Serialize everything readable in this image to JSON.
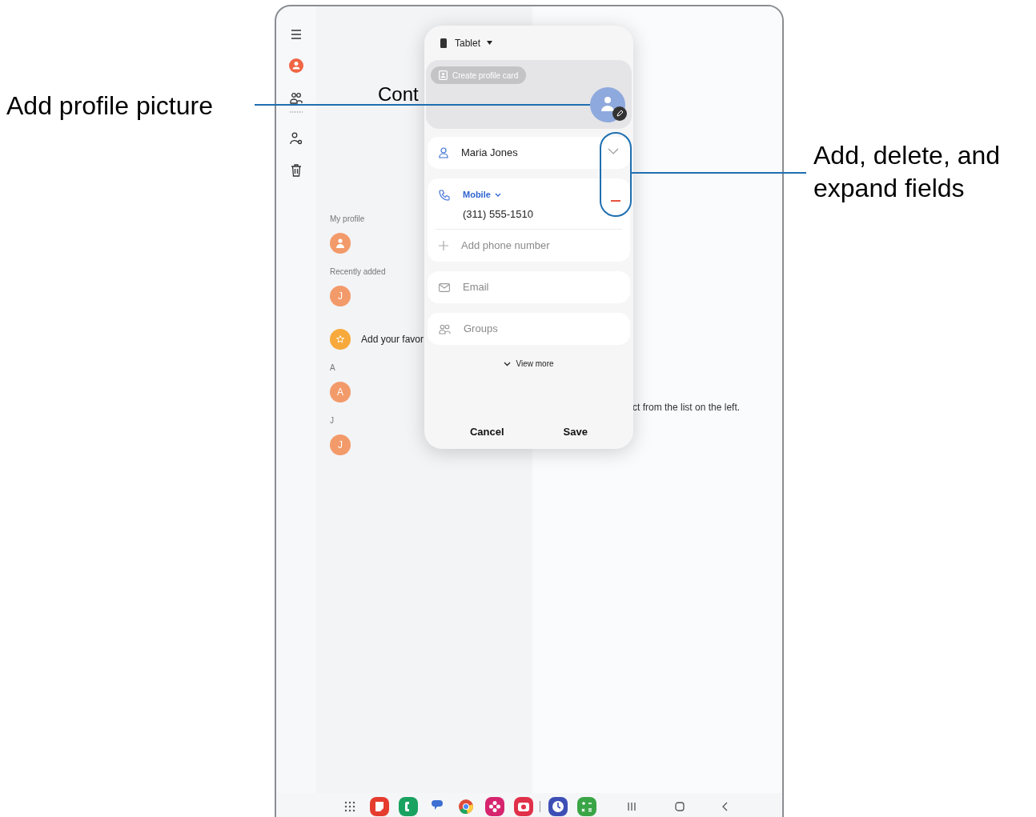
{
  "callouts": [
    {
      "text": "Add profile picture"
    },
    {
      "text": "Add, delete, and expand fields"
    }
  ],
  "contacts_list": {
    "title": "Cont",
    "items": [
      {
        "kind": "header",
        "text": "My profile"
      },
      {
        "kind": "profile_avatar"
      },
      {
        "kind": "header",
        "text": "Recently added"
      },
      {
        "kind": "avatar",
        "letter": "J"
      },
      {
        "kind": "favorite",
        "text": "Add your favor"
      },
      {
        "kind": "header",
        "text": "A"
      },
      {
        "kind": "avatar",
        "letter": "A"
      },
      {
        "kind": "header",
        "text": "J"
      },
      {
        "kind": "avatar",
        "letter": "J"
      }
    ]
  },
  "detail_hint": "ct from the list on the left.",
  "dialog": {
    "storage": "Tablet",
    "create_profile_card": "Create profile card",
    "name": "Maria Jones",
    "phone_label": "Mobile",
    "phone": "(311) 555-1510",
    "add_phone": "Add phone number",
    "email_placeholder": "Email",
    "groups_placeholder": "Groups",
    "view_more": "View more",
    "buttons": [
      "Cancel",
      "Save"
    ]
  }
}
